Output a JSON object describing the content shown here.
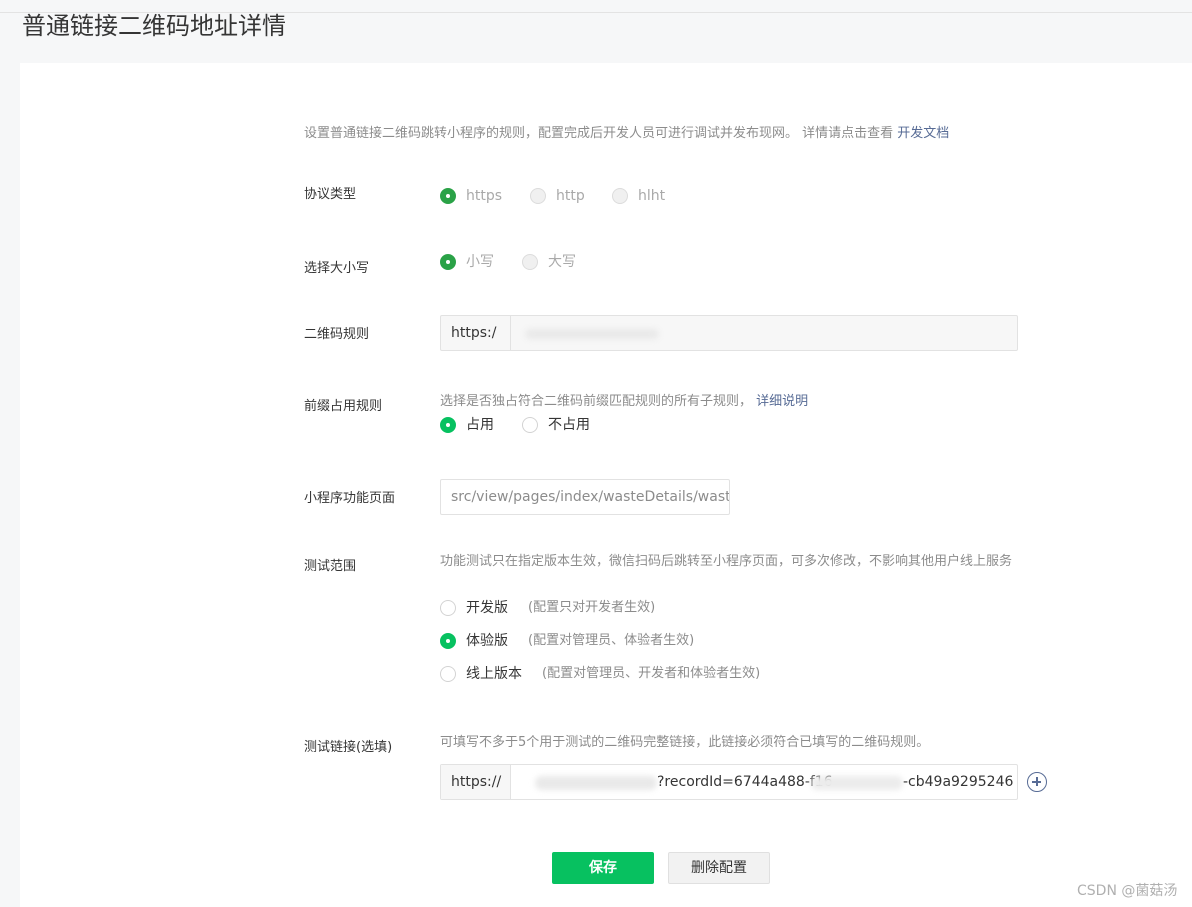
{
  "page": {
    "title": "普通链接二维码地址详情"
  },
  "intro": {
    "text": "设置普通链接二维码跳转小程序的规则，配置完成后开发人员可进行调试并发布现网。 详情请点击查看",
    "link": "开发文档"
  },
  "protocol": {
    "label": "协议类型",
    "options": [
      "https",
      "http",
      "hlht"
    ],
    "selected": "https"
  },
  "case": {
    "label": "选择大小写",
    "options": [
      "小写",
      "大写"
    ],
    "selected": "小写"
  },
  "qr_rule": {
    "label": "二维码规则",
    "prefix": "https:/"
  },
  "prefix_rule": {
    "label": "前缀占用规则",
    "hint": "选择是否独占符合二维码前缀匹配规则的所有子规则，",
    "link": "详细说明",
    "options": [
      "占用",
      "不占用"
    ],
    "selected": "占用"
  },
  "page_path": {
    "label": "小程序功能页面",
    "value": "src/view/pages/index/wasteDetails/wast"
  },
  "test_scope": {
    "label": "测试范围",
    "hint": "功能测试只在指定版本生效，微信扫码后跳转至小程序页面，可多次修改，不影响其他用户线上服务",
    "options": [
      {
        "label": "开发版",
        "note": "(配置只对开发者生效)"
      },
      {
        "label": "体验版",
        "note": "(配置对管理员、体验者生效)"
      },
      {
        "label": "线上版本",
        "note": "(配置对管理员、开发者和体验者生效)"
      }
    ],
    "selected": "体验版"
  },
  "test_link": {
    "label": "测试链接(选填)",
    "hint": "可填写不多于5个用于测试的二维码完整链接，此链接必须符合已填写的二维码规则。",
    "prefix": "https://",
    "value_part1": "?recordId=6744a488-f16",
    "value_part2": "-cb49a9295246"
  },
  "buttons": {
    "save": "保存",
    "delete": "删除配置"
  },
  "watermark": "CSDN @菌菇汤",
  "colors": {
    "accent": "#07c160",
    "link": "#576b95"
  }
}
